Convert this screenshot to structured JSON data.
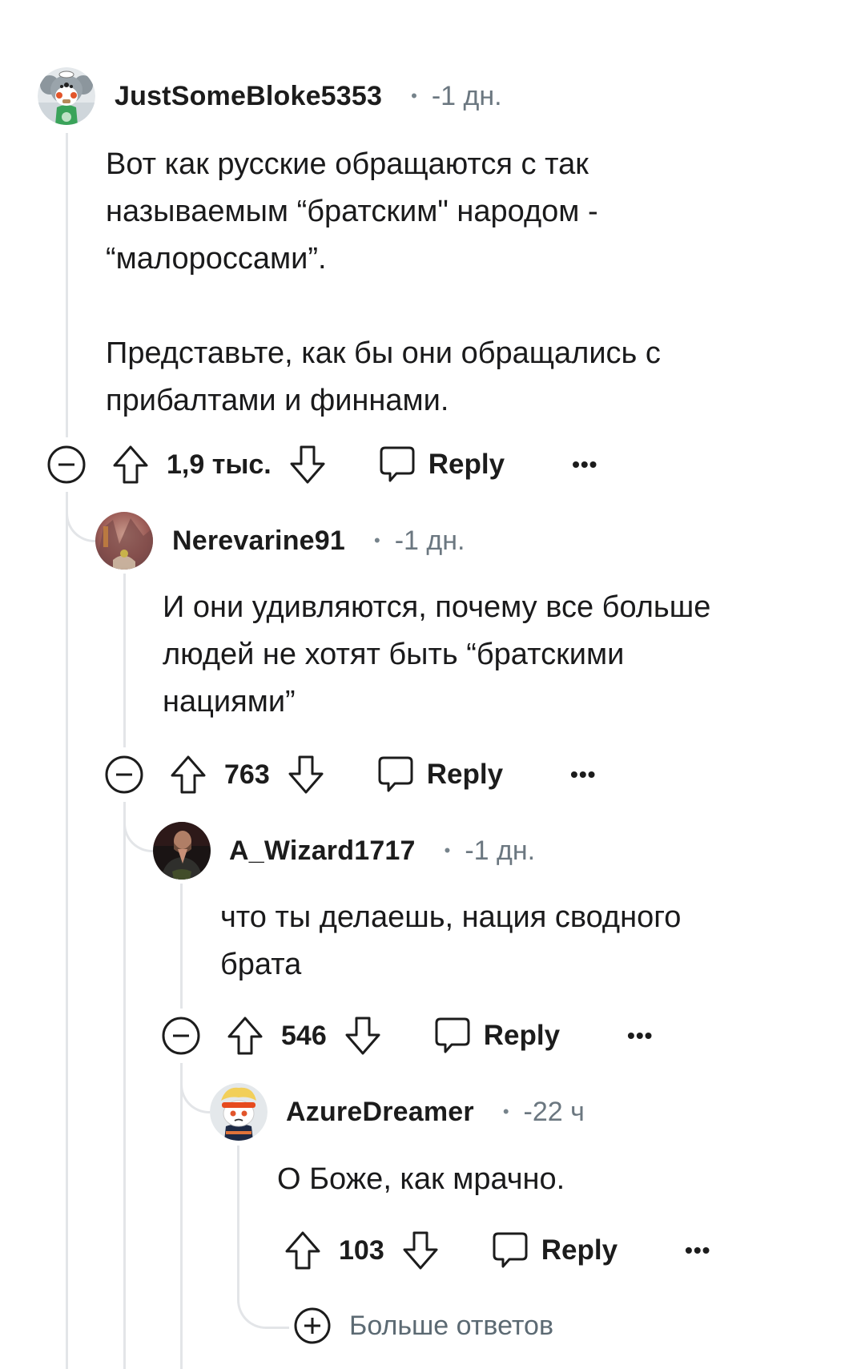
{
  "comments": [
    {
      "username": "JustSomeBloke5353",
      "separator": "•",
      "time": "-1 дн.",
      "avatar": "snoo-koala-avatar",
      "body": "Вот как русские обращаются с так\nназываемым “братским\" народом -\n“малороссами”.\n\nПредставьте, как бы они обращались с\nприбалтами и финнами.",
      "score": "1,9 тыс.",
      "reply_label": "Reply",
      "more_label": "•••",
      "collapsible": true
    },
    {
      "username": "Nerevarine91",
      "separator": "•",
      "time": "-1 дн.",
      "avatar": "painting-avatar",
      "body": "И они удивляются, почему все больше\nлюдей не хотят быть “братскими\nнациями”",
      "score": "763",
      "reply_label": "Reply",
      "more_label": "•••",
      "collapsible": true
    },
    {
      "username": "A_Wizard1717",
      "separator": "•",
      "time": "-1 дн.",
      "avatar": "photo-avatar",
      "body": "что ты делаешь, нация сводного\nбрата",
      "score": "546",
      "reply_label": "Reply",
      "more_label": "•••",
      "collapsible": true
    },
    {
      "username": "AzureDreamer",
      "separator": "•",
      "time": "-22 ч",
      "avatar": "snoo-headband-avatar",
      "body": "О Боже, как мрачно.",
      "score": "103",
      "reply_label": "Reply",
      "more_label": "•••",
      "collapsible": false
    }
  ],
  "more_replies": {
    "label": "Больше ответов"
  },
  "colors": {
    "text": "#1c1c1c",
    "meta": "#6b7780",
    "thread_line": "#e3e5e8",
    "more_replies": "#5c6a73"
  }
}
